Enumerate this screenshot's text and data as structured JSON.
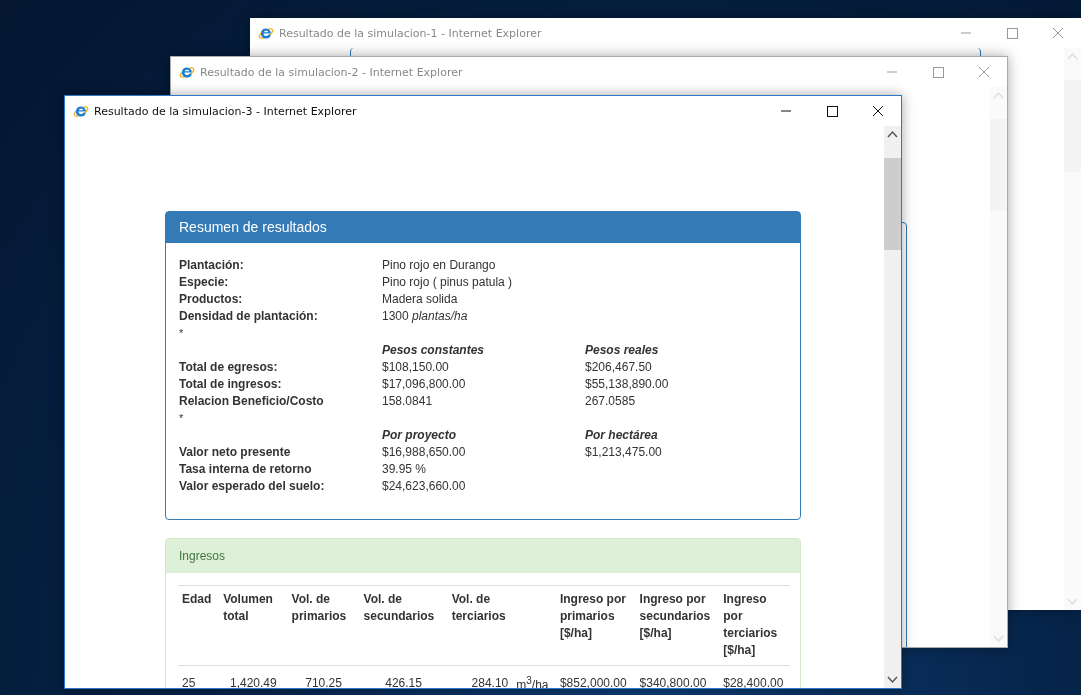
{
  "windows": [
    {
      "title": "Resultado de la simulacion-1 - Internet Explorer",
      "active": false
    },
    {
      "title": "Resultado de la simulacion-2 - Internet Explorer",
      "active": false
    },
    {
      "title": "Resultado de la simulacion-3 - Internet Explorer",
      "active": true
    }
  ],
  "summary": {
    "title": "Resumen de resultados",
    "rows": [
      {
        "kind": "row",
        "label": "Plantación:",
        "values": [
          "Pino rojo en Durango"
        ]
      },
      {
        "kind": "row",
        "label": "Especie:",
        "values": [
          "Pino rojo ( pinus patula )"
        ]
      },
      {
        "kind": "row",
        "label": "Productos:",
        "values": [
          "Madera solida"
        ]
      },
      {
        "kind": "row",
        "label": "Densidad de plantación:",
        "values": [
          "1300  *plantas/ha*"
        ]
      },
      {
        "kind": "note",
        "text": "*"
      },
      {
        "kind": "header",
        "values": [
          "Pesos constantes",
          "Pesos reales"
        ]
      },
      {
        "kind": "row",
        "label": "Total de egresos:",
        "values": [
          "$108,150.00",
          "$206,467.50"
        ]
      },
      {
        "kind": "row",
        "label": "Total de ingresos:",
        "values": [
          "$17,096,800.00",
          "$55,138,890.00"
        ]
      },
      {
        "kind": "row",
        "label": "Relacion Beneficio/Costo",
        "values": [
          "158.0841",
          "267.0585"
        ]
      },
      {
        "kind": "note",
        "text": "*"
      },
      {
        "kind": "header",
        "values": [
          "Por proyecto",
          "Por hectárea"
        ]
      },
      {
        "kind": "row",
        "label": "Valor neto presente",
        "values": [
          "$16,988,650.00",
          "$1,213,475.00"
        ]
      },
      {
        "kind": "row",
        "label": "Tasa interna de retorno",
        "values": [
          "39.95 %"
        ]
      },
      {
        "kind": "row",
        "label": "Valor esperado del suelo:",
        "values": [
          "$24,623,660.00"
        ]
      }
    ]
  },
  "income": {
    "title": "Ingresos",
    "columns": [
      {
        "kind": "text",
        "label": "Edad"
      },
      {
        "kind": "text",
        "label": "Volumen total"
      },
      {
        "kind": "text",
        "label": "Vol. de primarios"
      },
      {
        "kind": "text",
        "label": "Vol. de secundarios"
      },
      {
        "kind": "text",
        "label": "Vol. de terciarios"
      },
      {
        "kind": "unit"
      },
      {
        "kind": "text",
        "label": "Ingreso por primarios [$/ha]"
      },
      {
        "kind": "text",
        "label": "Ingreso por secundarios [$/ha]"
      },
      {
        "kind": "text",
        "label": "Ingreso por terciarios [$/ha]"
      }
    ],
    "rows": [
      [
        "25",
        "1,420.49",
        "710.25",
        "426.15",
        "284.10",
        "m$^{3}$/ha",
        "$852,000.00",
        "$340,800.00",
        "$28,400.00"
      ]
    ]
  }
}
